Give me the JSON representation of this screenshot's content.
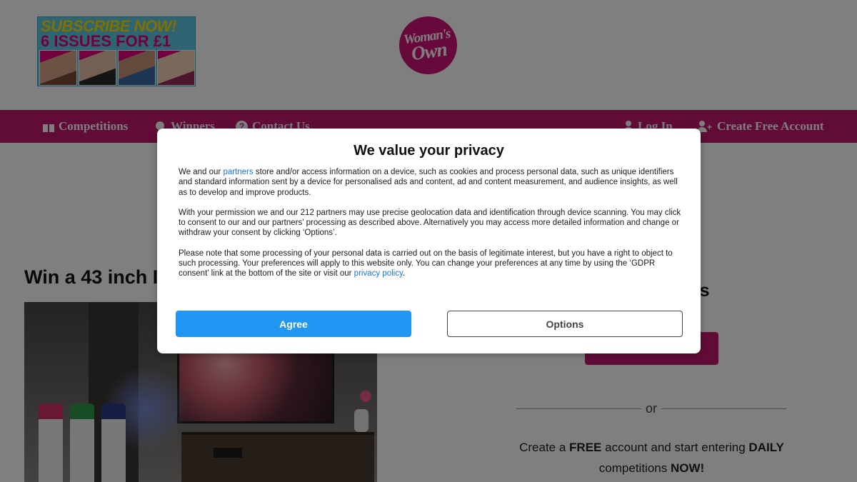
{
  "header": {
    "promo": {
      "line1": "SUBSCRIBE NOW!",
      "line2": "6 ISSUES FOR £1"
    },
    "logo": {
      "line1": "Woman's",
      "line2": "Own"
    }
  },
  "nav": {
    "competitions": "Competitions",
    "winners": "Winners",
    "contact": "Contact Us",
    "login": "Log In",
    "create_account": "Create Free Account"
  },
  "main": {
    "headline": "Win a 43 inch I",
    "side_title": "ers",
    "divider_text": "or",
    "signup": {
      "part1": "Create a ",
      "free": "FREE",
      "part2": " account and start entering ",
      "daily": "DAILY",
      "part3": " competitions ",
      "now": "NOW!"
    }
  },
  "consent": {
    "title": "We value your privacy",
    "p1_before": "We and our ",
    "p1_link": "partners",
    "p1_after": " store and/or access information on a device, such as cookies and process personal data, such as unique identifiers and standard information sent by a device for personalised ads and content, ad and content measurement, and audience insights, as well as to develop and improve products.",
    "p2": "With your permission we and our 212 partners may use precise geolocation data and identification through device scanning. You may click to consent to our and our partners' processing as described above. Alternatively you may access more detailed information and change or withdraw your consent by clicking ‘Options’.",
    "p3_before": "Please note that some processing of your personal data is carried out on the basis of legitimate interest, but you have a right to object to such processing. Your preferences will apply to this website only. You can change your preferences at any time by using the ‘GDPR consent’ link at the bottom of the site or visit our ",
    "p3_link": "privacy policy",
    "p3_after": ".",
    "agree_label": "Agree",
    "options_label": "Options"
  },
  "colors": {
    "brand": "#c2186f",
    "agree": "#2196f3",
    "link": "#1a73e8"
  }
}
